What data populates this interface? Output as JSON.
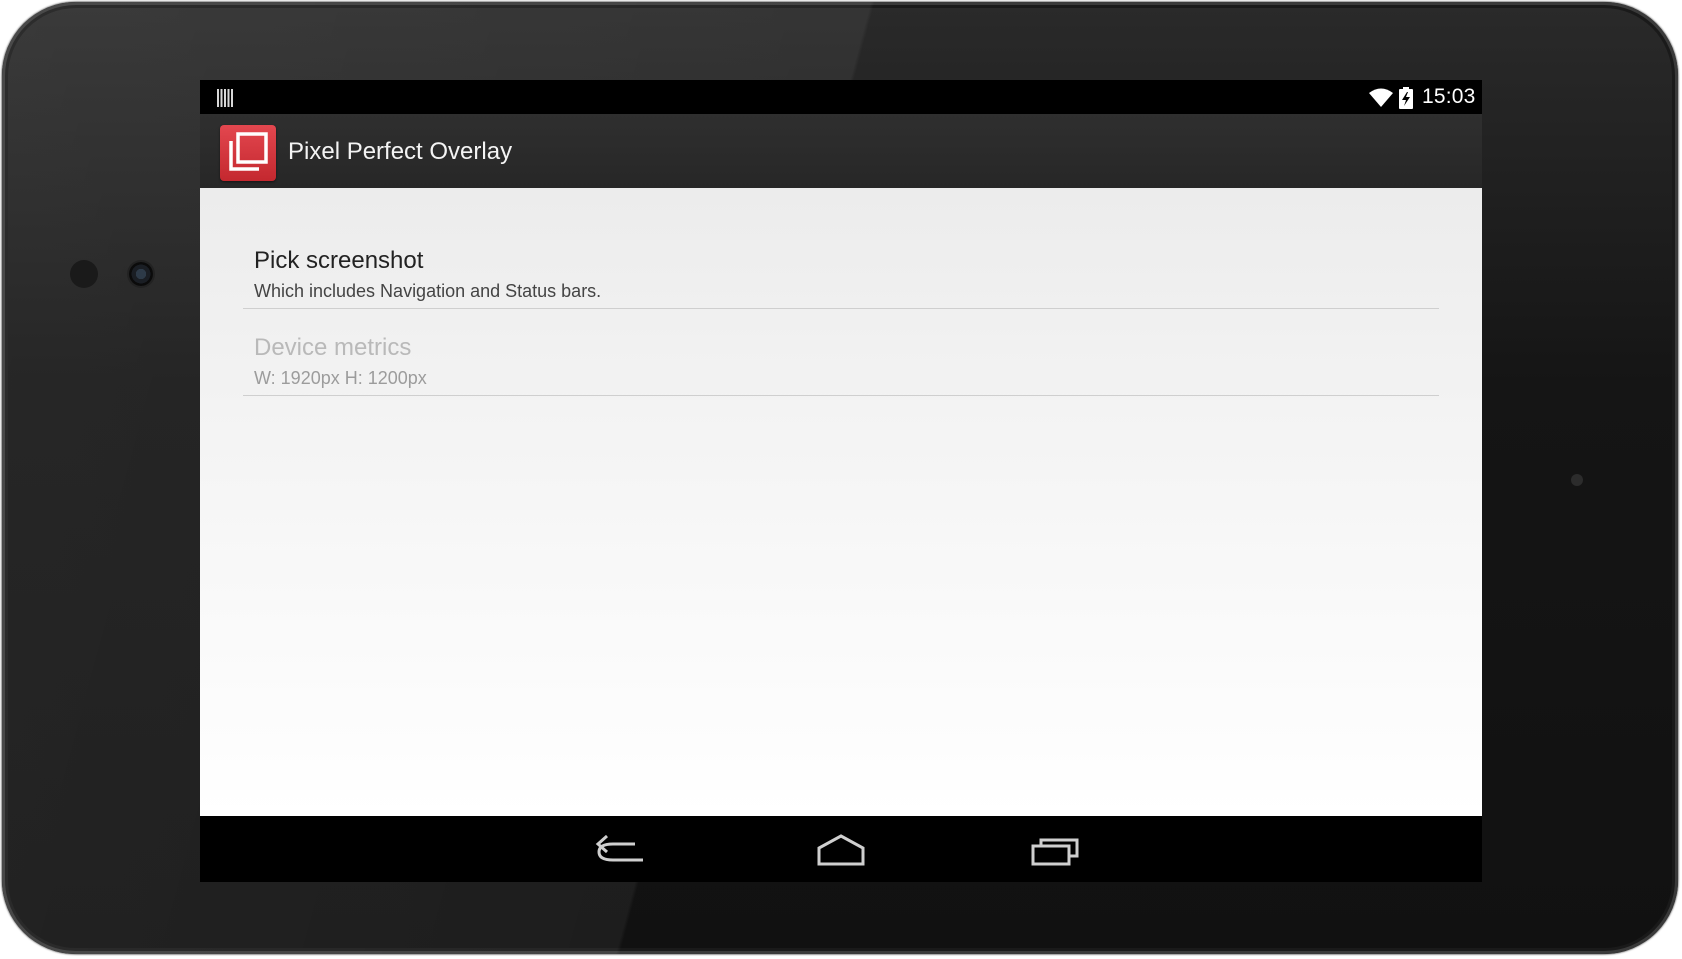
{
  "status_bar": {
    "time": "15:03",
    "icons": [
      "notification-barcode-icon",
      "wifi-icon",
      "battery-charging-icon"
    ]
  },
  "action_bar": {
    "title": "Pixel Perfect Overlay",
    "app_icon": "overlay-app-icon",
    "colors": {
      "icon_red": "#d63a41",
      "bar_bg": "#2b2b2b"
    }
  },
  "preferences": [
    {
      "title": "Pick screenshot",
      "summary": "Which includes Navigation and Status bars.",
      "enabled": true
    },
    {
      "title": "Device metrics",
      "summary": "W: 1920px H: 1200px",
      "enabled": false
    }
  ],
  "nav_bar": {
    "buttons": [
      "back-icon",
      "home-icon",
      "recents-icon"
    ]
  }
}
